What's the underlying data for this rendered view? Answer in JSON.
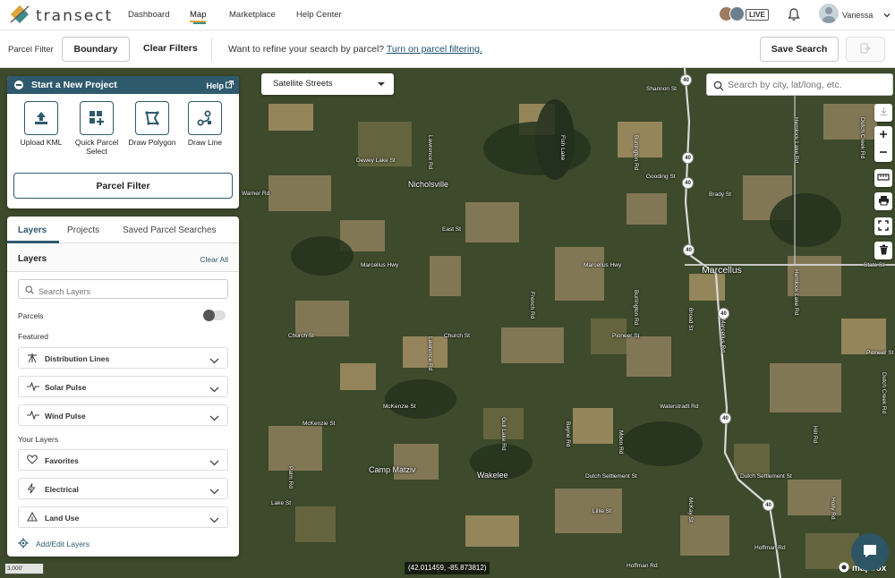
{
  "app": {
    "logo_text": "transect"
  },
  "nav": {
    "links": [
      "Dashboard",
      "Map",
      "Marketplace",
      "Help Center"
    ],
    "live_badge": "LIVE",
    "user_name": "Vanessa"
  },
  "filterbar": {
    "label": "Parcel Filter",
    "boundary": "Boundary",
    "clear": "Clear Filters",
    "refine_text": "Want to refine your search by parcel?",
    "refine_link": "Turn on parcel filtering.",
    "save": "Save Search"
  },
  "project": {
    "header": "Start a New Project",
    "help": "Help",
    "tools": [
      "Upload KML",
      "Quick Parcel Select",
      "Draw Polygon",
      "Draw Line"
    ],
    "parcel_filter": "Parcel Filter"
  },
  "layers": {
    "tabs": [
      "Layers",
      "Projects",
      "Saved Parcel Searches"
    ],
    "title": "Layers",
    "clear_all": "Clear All",
    "search_placeholder": "Search Layers",
    "parcels_label": "Parcels",
    "parcels_on": false,
    "featured_label": "Featured",
    "featured": [
      "Distribution Lines",
      "Solar Pulse",
      "Wind Pulse"
    ],
    "your_layers_label": "Your Layers",
    "your_layers": [
      "Favorites",
      "Electrical",
      "Land Use"
    ],
    "add_edit": "Add/Edit Layers"
  },
  "map": {
    "basemap": "Satellite Streets",
    "search_placeholder": "Search by city, lat/long, etc.",
    "scale": "3,000'",
    "coords": "(42.011459, -85.873812)",
    "attribution": "mapbox",
    "labels": {
      "shannon": "Shannon St",
      "dewey": "Dewey Lake St",
      "nicholsville": "Nicholsville",
      "warner": "Warner Rd",
      "lawrence1": "Lawrence Rd",
      "burlington1": "Burlington Rd",
      "gooding": "Gooding St",
      "brady": "Brady St",
      "dutch_creek": "Dutch Creek Rd",
      "hemlock_lake": "Hemlock Lake Rd",
      "fish_lake": "Fish Lake",
      "east": "East St",
      "marcellus_hwy1": "Marcellus Hwy",
      "marcellus_hwy2": "Marcellus Hwy",
      "marcellus": "Marcellus",
      "state": "State St",
      "hemlock_lake2": "Hemlock Lake Rd",
      "church1": "Church St",
      "church2": "Church St",
      "pioneer": "Pioneer St",
      "pioneer2": "Pioneer St",
      "waterstradt": "Waterstradt Rd",
      "mckenzie1": "McKenzie St",
      "mckenzie2": "McKenzie St",
      "camp": "Camp Matziv",
      "wakelee": "Wakelee",
      "dutch1": "Dutch Settlement St",
      "dutch2": "Dutch Settlement St",
      "lake": "Lake St",
      "lillie": "Lillie St",
      "hoffman": "Hoffman Rd",
      "hoffman2": "Hoffman Rd",
      "lawrence2": "Lawrence Rd",
      "palm": "Palm Rd",
      "gull_lake": "Gull Lake Rd",
      "bayne": "Bayne Rd",
      "moon": "Moon Rd",
      "french": "French Rd",
      "broad": "Broad St",
      "burlington2": "Burlington Rd",
      "dutch_creek2": "Dutch Creek Rd",
      "hill": "Hill Rd",
      "mckay": "McKay St",
      "marcellus_rd": "Marcellus Rd",
      "holly": "Holly Rd"
    },
    "shields": [
      "40",
      "40",
      "40",
      "40",
      "40",
      "40",
      "40"
    ]
  }
}
